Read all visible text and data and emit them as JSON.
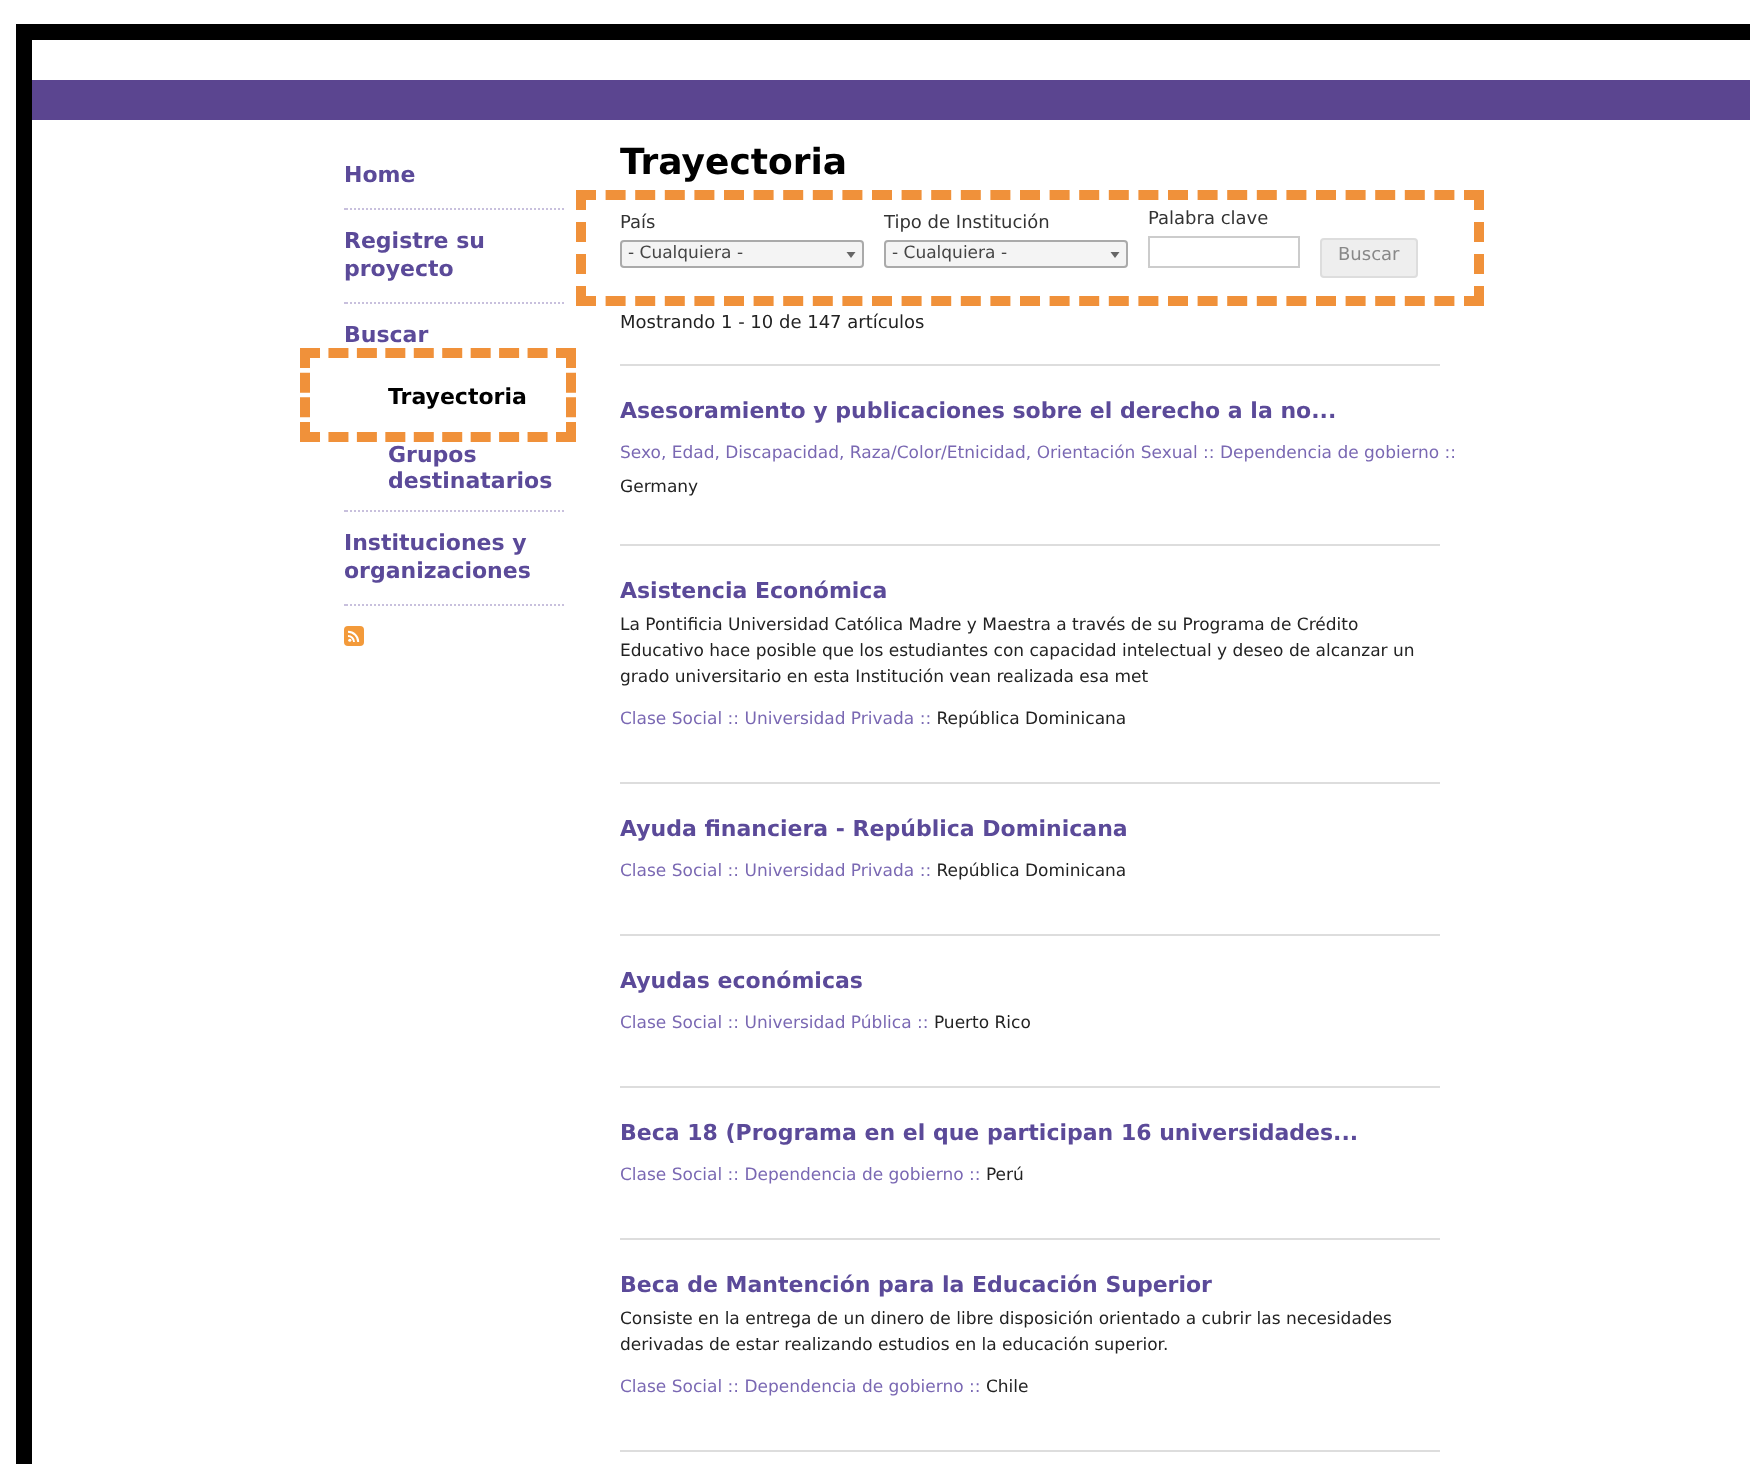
{
  "sidebar": {
    "items": [
      {
        "label": "Home",
        "selected": false
      },
      {
        "label": "Registre su proyecto",
        "selected": false
      },
      {
        "label": "Buscar",
        "selected": false,
        "children": [
          {
            "label": "Trayectoria",
            "selected": true,
            "highlighted": true
          },
          {
            "label": "Grupos destinatarios",
            "selected": false,
            "highlighted": false
          }
        ]
      },
      {
        "label": "Instituciones y organizaciones",
        "selected": false
      }
    ]
  },
  "page_title": "Trayectoria",
  "filters": {
    "highlighted": true,
    "fields": [
      {
        "kind": "select",
        "label": "País",
        "value": "- Cualquiera -"
      },
      {
        "kind": "select",
        "label": "Tipo de Institución",
        "value": "- Cualquiera -"
      },
      {
        "kind": "text",
        "label": "Palabra clave"
      }
    ],
    "button": {
      "label": "Buscar",
      "disabled": true
    }
  },
  "count": "Mostrando 1 - 10 de 147 artículos",
  "articles": [
    {
      "title": "Asesoramiento y publicaciones sobre el derecho a la no...",
      "meta": [
        {
          "kind": "link",
          "text": "Sexo"
        },
        {
          "kind": "sep",
          "text": ", "
        },
        {
          "kind": "link",
          "text": "Edad"
        },
        {
          "kind": "sep",
          "text": ", "
        },
        {
          "kind": "link",
          "text": "Discapacidad"
        },
        {
          "kind": "sep",
          "text": ", "
        },
        {
          "kind": "link",
          "text": "Raza/Color/Etnicidad"
        },
        {
          "kind": "sep",
          "text": ", "
        },
        {
          "kind": "link",
          "text": "Orientación Sexual"
        },
        {
          "kind": "sep",
          "text": " :: "
        },
        {
          "kind": "link",
          "text": "Dependencia de gobierno"
        },
        {
          "kind": "sep",
          "text": " ::"
        }
      ],
      "country": "Germany"
    },
    {
      "title": "Asistencia Económica",
      "description": "La Pontificia Universidad Católica Madre y Maestra a través de su Programa de Crédito Educativo hace posible que los estudiantes con capacidad intelectual y deseo de alcanzar un grado universitario en esta Institución vean realizada esa met",
      "meta": [
        {
          "kind": "link",
          "text": "Clase Social"
        },
        {
          "kind": "sep",
          "text": " :: "
        },
        {
          "kind": "link",
          "text": "Universidad Privada"
        },
        {
          "kind": "sep",
          "text": " :: "
        },
        {
          "kind": "plain",
          "text": "República Dominicana"
        }
      ]
    },
    {
      "title": "Ayuda financiera - República Dominicana",
      "meta": [
        {
          "kind": "link",
          "text": "Clase Social"
        },
        {
          "kind": "sep",
          "text": " :: "
        },
        {
          "kind": "link",
          "text": "Universidad Privada"
        },
        {
          "kind": "sep",
          "text": " :: "
        },
        {
          "kind": "plain",
          "text": "República Dominicana"
        }
      ]
    },
    {
      "title": "Ayudas económicas",
      "meta": [
        {
          "kind": "link",
          "text": "Clase Social"
        },
        {
          "kind": "sep",
          "text": " :: "
        },
        {
          "kind": "link",
          "text": "Universidad Pública"
        },
        {
          "kind": "sep",
          "text": " :: "
        },
        {
          "kind": "plain",
          "text": "Puerto Rico"
        }
      ]
    },
    {
      "title": "Beca 18 (Programa en el que participan 16 universidades...",
      "meta": [
        {
          "kind": "link",
          "text": "Clase Social"
        },
        {
          "kind": "sep",
          "text": " :: "
        },
        {
          "kind": "link",
          "text": "Dependencia de gobierno"
        },
        {
          "kind": "sep",
          "text": " :: "
        },
        {
          "kind": "plain",
          "text": "Perú"
        }
      ]
    },
    {
      "title": "Beca de Mantención para la Educación Superior",
      "description": "Consiste en la entrega de un dinero de libre disposición orientado a cubrir las necesidades derivadas de estar realizando estudios en la educación superior.",
      "meta": [
        {
          "kind": "link",
          "text": "Clase Social"
        },
        {
          "kind": "sep",
          "text": " :: "
        },
        {
          "kind": "link",
          "text": "Dependencia de gobierno"
        },
        {
          "kind": "sep",
          "text": " :: "
        },
        {
          "kind": "plain",
          "text": "Chile"
        }
      ]
    }
  ]
}
